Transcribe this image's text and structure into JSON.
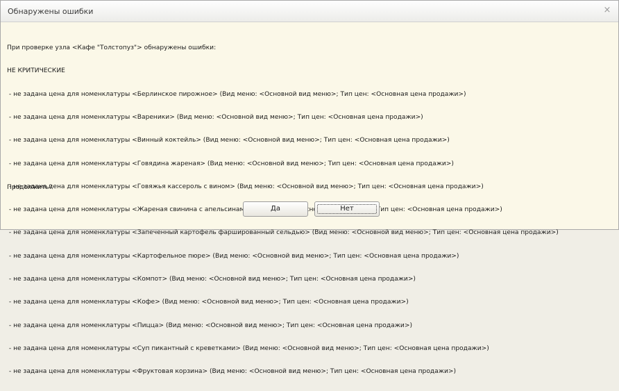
{
  "window": {
    "title": "Обнаружены ошибки",
    "close_glyph": "×"
  },
  "message": {
    "header": "При проверке узла <Кафе \"Толстопуз\"> обнаружены ошибки:",
    "category": "НЕ КРИТИЧЕСКИЕ",
    "lines": [
      " - не задана цена для номенклатуры <Берлинское пирожное> (Вид меню: <Основной вид меню>; Тип цен: <Основная цена продажи>)",
      " - не задана цена для номенклатуры <Вареники> (Вид меню: <Основной вид меню>; Тип цен: <Основная цена продажи>)",
      " - не задана цена для номенклатуры <Винный коктейль> (Вид меню: <Основной вид меню>; Тип цен: <Основная цена продажи>)",
      " - не задана цена для номенклатуры <Говядина жареная> (Вид меню: <Основной вид меню>; Тип цен: <Основная цена продажи>)",
      " - не задана цена для номенклатуры <Говяжья кассероль с вином> (Вид меню: <Основной вид меню>; Тип цен: <Основная цена продажи>)",
      " - не задана цена для номенклатуры <Жареная свинина с апельсинами> (Вид меню: <Основной вид меню>; Тип цен: <Основная цена продажи>)",
      " - не задана цена для номенклатуры <Запеченный картофель фаршированный сельдью> (Вид меню: <Основной вид меню>; Тип цен: <Основная цена продажи>)",
      " - не задана цена для номенклатуры <Картофельное пюре> (Вид меню: <Основной вид меню>; Тип цен: <Основная цена продажи>)",
      " - не задана цена для номенклатуры <Компот> (Вид меню: <Основной вид меню>; Тип цен: <Основная цена продажи>)",
      " - не задана цена для номенклатуры <Кофе> (Вид меню: <Основной вид меню>; Тип цен: <Основная цена продажи>)",
      " - не задана цена для номенклатуры <Пицца> (Вид меню: <Основной вид меню>; Тип цен: <Основная цена продажи>)",
      " - не задана цена для номенклатуры <Суп пикантный с креветками> (Вид меню: <Основной вид меню>; Тип цен: <Основная цена продажи>)",
      " - не задана цена для номенклатуры <Фруктовая корзина> (Вид меню: <Основной вид меню>; Тип цен: <Основная цена продажи>)"
    ]
  },
  "question": "Продолжить?",
  "buttons": {
    "yes": "Да",
    "no": "Нет"
  }
}
